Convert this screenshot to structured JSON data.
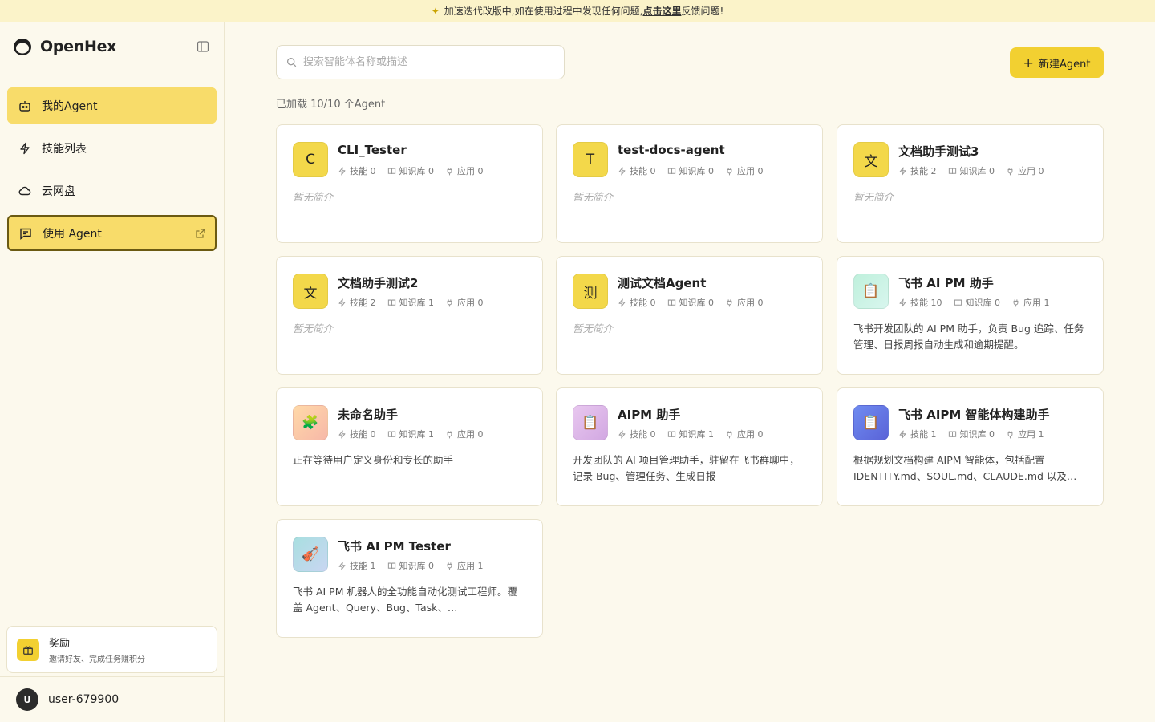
{
  "banner": {
    "icon": "sparkles-icon",
    "text_before": "加速迭代改版中,如在使用过程中发现任何问题,",
    "link": "点击这里",
    "text_after": "反馈问题!"
  },
  "sidebar": {
    "brand": "OpenHex",
    "nav": [
      {
        "label": "我的Agent",
        "icon": "robot-icon"
      },
      {
        "label": "技能列表",
        "icon": "lightning-icon"
      },
      {
        "label": "云网盘",
        "icon": "cloud-icon"
      },
      {
        "label": "使用 Agent",
        "icon": "chat-icon"
      }
    ],
    "reward": {
      "title": "奖励",
      "subtitle": "邀请好友、完成任务赚积分"
    },
    "user": {
      "initial": "U",
      "name": "user-679900"
    }
  },
  "main": {
    "search_placeholder": "搜索智能体名称或描述",
    "new_button": "新建Agent",
    "loaded_text": "已加载 10/10 个Agent"
  },
  "agents": [
    {
      "name": "CLI_Tester",
      "avatar": "C",
      "avatar_style": "yellow",
      "skills": "技能 0",
      "kb": "知识库 0",
      "apps": "应用 0",
      "desc": "暂无简介",
      "empty": true
    },
    {
      "name": "test-docs-agent",
      "avatar": "T",
      "avatar_style": "yellow",
      "skills": "技能 0",
      "kb": "知识库 0",
      "apps": "应用 0",
      "desc": "暂无简介",
      "empty": true
    },
    {
      "name": "文档助手测试3",
      "avatar": "文",
      "avatar_style": "yellow",
      "skills": "技能 2",
      "kb": "知识库 0",
      "apps": "应用 0",
      "desc": "暂无简介",
      "empty": true
    },
    {
      "name": "文档助手测试2",
      "avatar": "文",
      "avatar_style": "yellow",
      "skills": "技能 2",
      "kb": "知识库 1",
      "apps": "应用 0",
      "desc": "暂无简介",
      "empty": true
    },
    {
      "name": "测试文档Agent",
      "avatar": "测",
      "avatar_style": "yellow",
      "skills": "技能 0",
      "kb": "知识库 0",
      "apps": "应用 0",
      "desc": "暂无简介",
      "empty": true
    },
    {
      "name": "飞书 AI PM 助手",
      "avatar": "📋",
      "avatar_style": "mint",
      "skills": "技能 10",
      "kb": "知识库 0",
      "apps": "应用 1",
      "desc": "飞书开发团队的 AI PM 助手，负责 Bug 追踪、任务管理、日报周报自动生成和逾期提醒。",
      "empty": false
    },
    {
      "name": "未命名助手",
      "avatar": "🧩",
      "avatar_style": "peach",
      "skills": "技能 0",
      "kb": "知识库 1",
      "apps": "应用 0",
      "desc": "正在等待用户定义身份和专长的助手",
      "empty": false
    },
    {
      "name": "AIPM 助手",
      "avatar": "📋",
      "avatar_style": "lilac",
      "skills": "技能 0",
      "kb": "知识库 1",
      "apps": "应用 0",
      "desc": "开发团队的 AI 项目管理助手，驻留在飞书群聊中，记录 Bug、管理任务、生成日报",
      "empty": false
    },
    {
      "name": "飞书 AIPM 智能体构建助手",
      "avatar": "📋",
      "avatar_style": "indigo",
      "skills": "技能 1",
      "kb": "知识库 0",
      "apps": "应用 1",
      "desc": "根据规划文档构建 AIPM 智能体，包括配置 IDENTITY.md、SOUL.md、CLAUDE.md 以及…",
      "empty": false
    },
    {
      "name": "飞书 AI PM Tester",
      "avatar": "🎻",
      "avatar_style": "sky",
      "skills": "技能 1",
      "kb": "知识库 0",
      "apps": "应用 1",
      "desc": "飞书 AI PM 机器人的全功能自动化测试工程师。覆盖 Agent、Query、Bug、Task、…",
      "empty": false
    }
  ]
}
